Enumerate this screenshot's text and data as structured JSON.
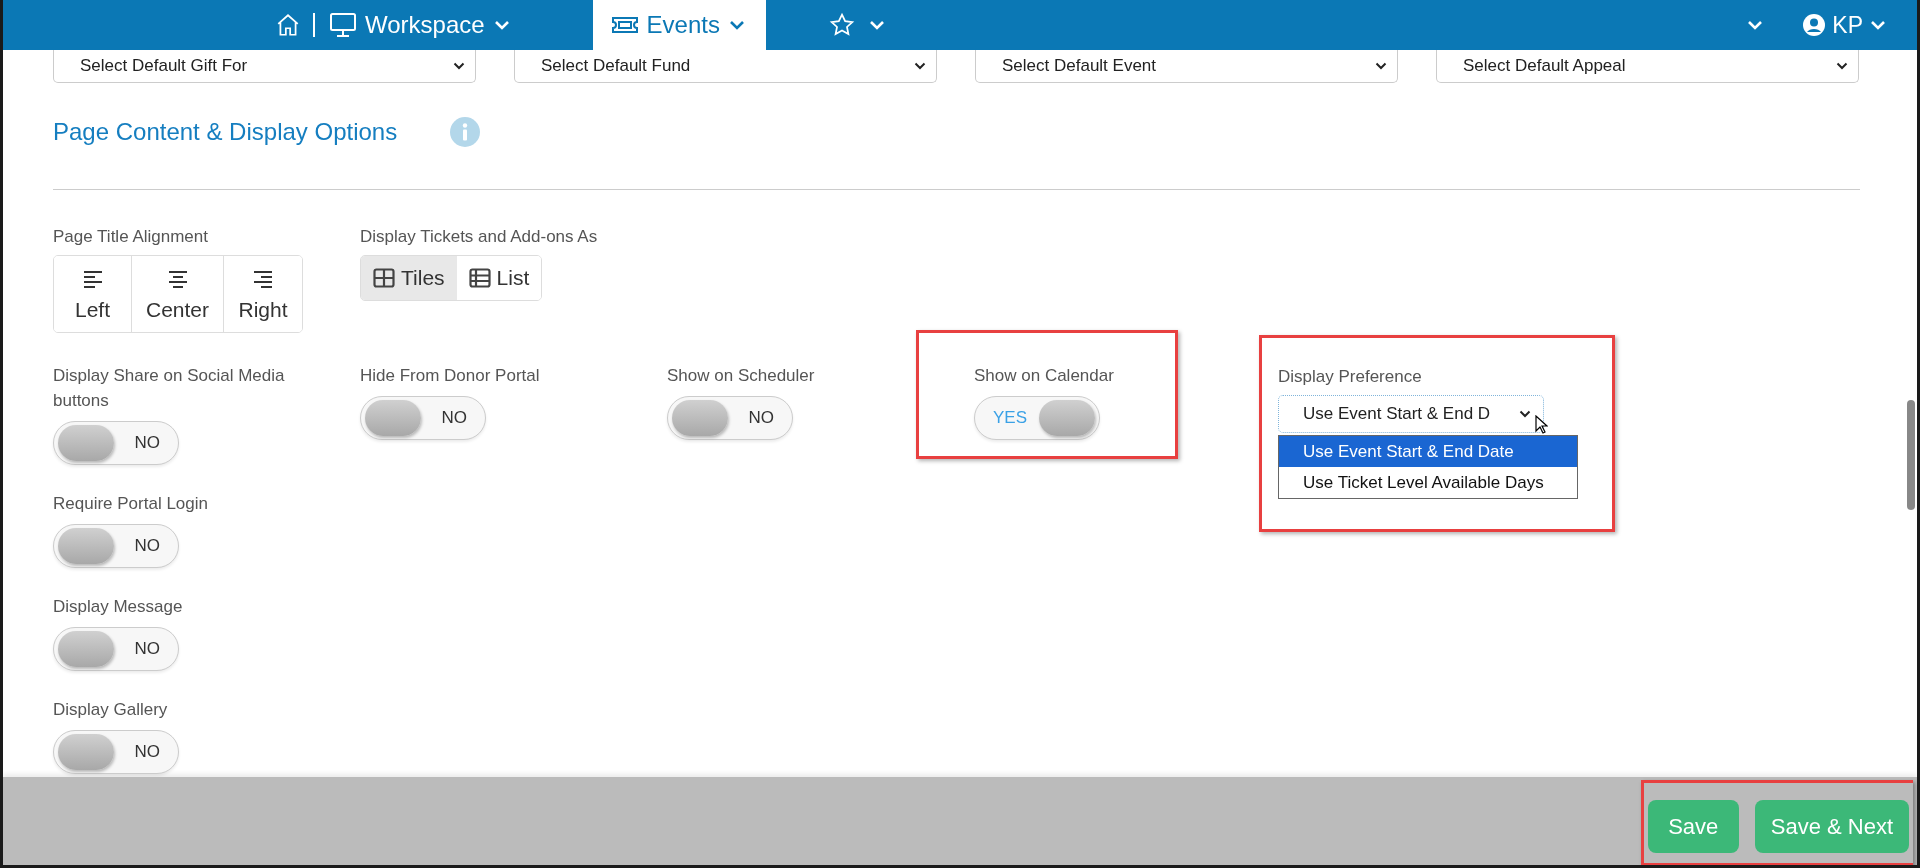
{
  "nav": {
    "items": [
      {
        "kind": "home"
      },
      {
        "kind": "workspace",
        "label": "Workspace",
        "selected": false
      },
      {
        "kind": "events",
        "label": "Events",
        "selected": true
      },
      {
        "kind": "favorites"
      }
    ],
    "user": {
      "initials": "KP"
    }
  },
  "default_selects": [
    {
      "placeholder": "Select Default Gift For"
    },
    {
      "placeholder": "Select Default Fund"
    },
    {
      "placeholder": "Select Default Event"
    },
    {
      "placeholder": "Select Default Appeal"
    }
  ],
  "section": {
    "title": "Page Content & Display Options"
  },
  "title_alignment": {
    "label": "Page Title Alignment",
    "options": [
      {
        "kind": "left",
        "label": "Left",
        "selected": false
      },
      {
        "kind": "center",
        "label": "Center",
        "selected": false
      },
      {
        "kind": "right",
        "label": "Right",
        "selected": false
      }
    ]
  },
  "tickets_display": {
    "label": "Display Tickets and Add-ons As",
    "options": [
      {
        "kind": "tiles",
        "label": "Tiles",
        "selected": true
      },
      {
        "kind": "list",
        "label": "List",
        "selected": false
      }
    ]
  },
  "left_toggles": [
    {
      "label": "Display Share on Social Media buttons",
      "on": false,
      "state_text": "NO",
      "highlighted": false
    },
    {
      "label": "Require Portal Login",
      "on": false,
      "state_text": "NO",
      "highlighted": false
    },
    {
      "label": "Display Message",
      "on": false,
      "state_text": "NO",
      "highlighted": false
    },
    {
      "label": "Display Gallery",
      "on": false,
      "state_text": "NO",
      "highlighted": false
    }
  ],
  "row_toggles": [
    {
      "label": "Hide From Donor Portal",
      "on": false,
      "state_text": "NO",
      "highlighted": false
    },
    {
      "label": "Show on Scheduler",
      "on": false,
      "state_text": "NO",
      "highlighted": false
    },
    {
      "label": "Show on Calendar",
      "on": true,
      "state_text": "YES",
      "highlighted": true
    }
  ],
  "display_preference": {
    "label": "Display Preference",
    "value": "Use Event Start & End D",
    "expanded": true,
    "highlighted": true,
    "options": [
      {
        "label": "Use Event Start & End Date",
        "selected": true
      },
      {
        "label": "Use Ticket Level Available Days",
        "selected": false
      }
    ]
  },
  "footer": {
    "highlighted": true,
    "buttons": [
      {
        "label": "Save"
      },
      {
        "label": "Save & Next"
      }
    ]
  }
}
